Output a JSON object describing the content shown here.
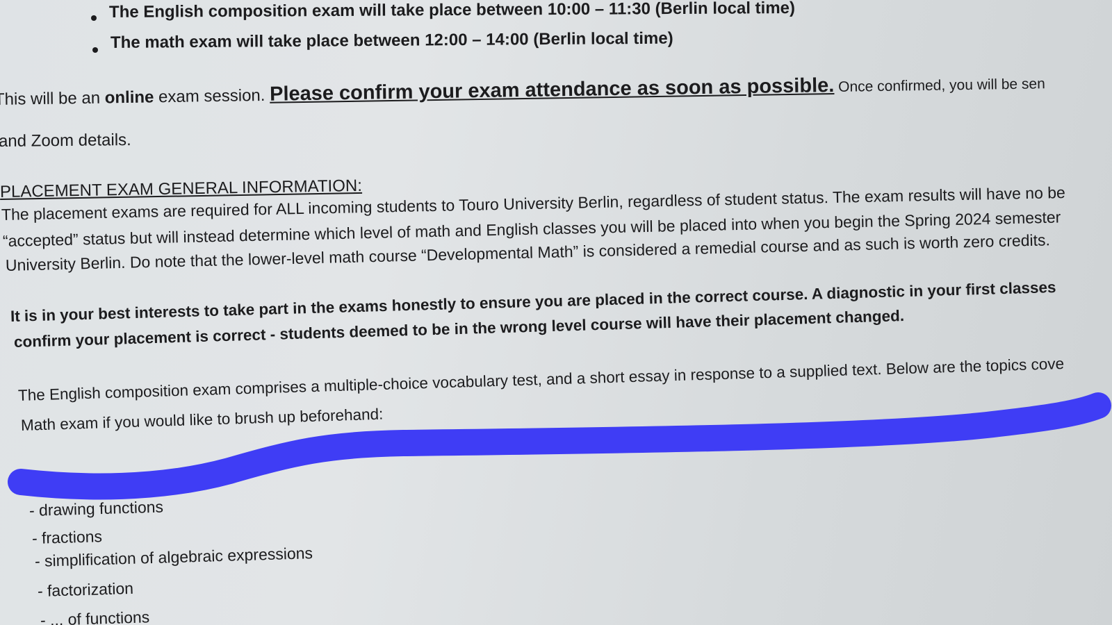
{
  "schedule": {
    "items": [
      "The English composition exam will take place between 10:00 – 11:30 (Berlin local time)",
      "The math exam will take place between 12:00 – 14:00 (Berlin local time)"
    ]
  },
  "session": {
    "prefix": "This will be an ",
    "online": "online",
    "middle": " exam session. ",
    "confirm": "Please confirm your exam attendance as soon as possible.",
    "suffix": " Once confirmed, you will be sen",
    "line2": "and Zoom details."
  },
  "general": {
    "heading": "PLACEMENT EXAM GENERAL INFORMATION:",
    "lines": [
      "The placement exams are required for ALL incoming students to Touro University Berlin, regardless of student status. The exam results will have no be",
      "“accepted” status but will instead determine which level of math and English classes you will be placed into when you begin the Spring 2024 semester",
      "University Berlin. Do note that the lower-level math course “Developmental Math” is considered a remedial course and as such is worth zero credits."
    ]
  },
  "honesty": {
    "lines": [
      "It is in your best interests to take part in the exams honestly to ensure you are placed in the correct course. A diagnostic in your first classes",
      "confirm your placement is correct - students deemed to be in the wrong level course will have their placement changed."
    ]
  },
  "english": {
    "lines": [
      "The English composition exam comprises a multiple-choice vocabulary test, and a short essay in response to a supplied text. Below are the topics cove",
      "Math exam if you would like to brush up beforehand:"
    ]
  },
  "topics": [
    "- drawing functions",
    "- fractions",
    "- simplification of algebraic expressions",
    "- factorization",
    "- ... of functions"
  ],
  "colors": {
    "marker": "#3f3df5",
    "text": "#1c1c1e"
  }
}
